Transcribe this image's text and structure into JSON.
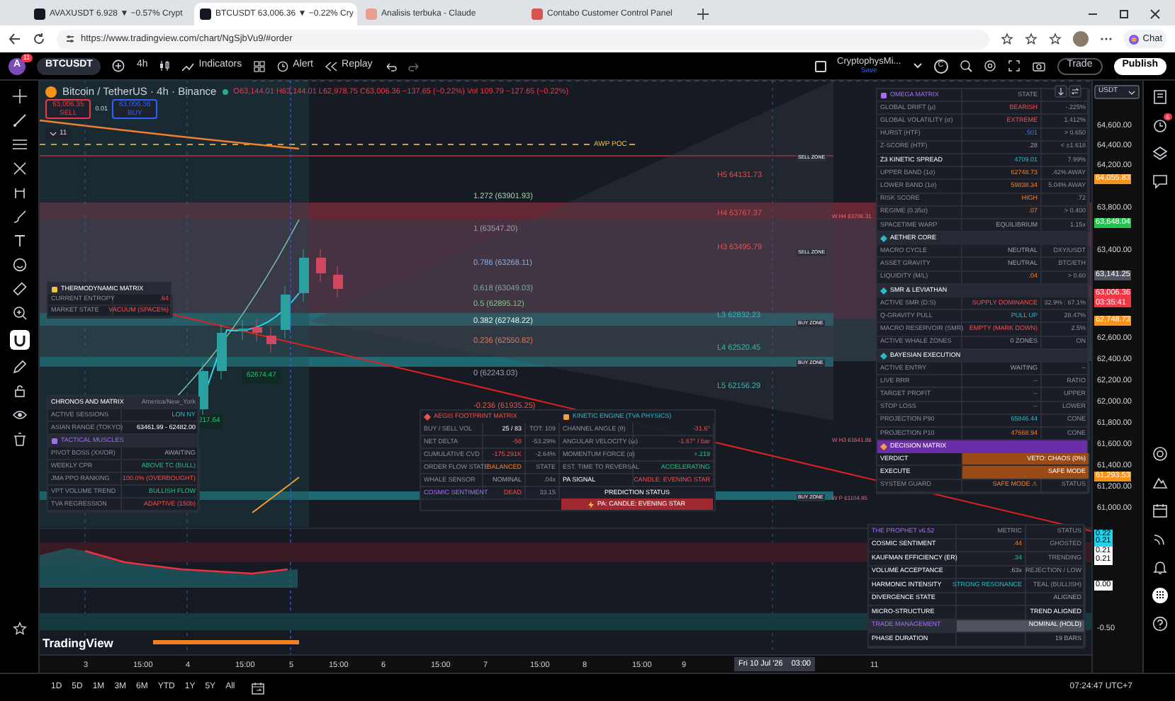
{
  "browser": {
    "tabs": [
      {
        "title": "AVAXUSDT 6.928 ▼ −0.57% Crypt",
        "selected": false
      },
      {
        "title": "BTCUSDT 63,006.36 ▼ −0.22% Cry",
        "selected": true
      },
      {
        "title": "Analisis terbuka - Claude",
        "selected": false
      },
      {
        "title": "Contabo Customer Control Panel",
        "selected": false
      }
    ],
    "url": "https://www.tradingview.com/chart/NgSjbVu9/#order",
    "chat": "Chat"
  },
  "header": {
    "avatar": "A",
    "badge": "11",
    "symbol": "BTCUSDT",
    "interval": "4h",
    "indicators": "Indicators",
    "alert": "Alert",
    "replay": "Replay",
    "layout": "CryptophysMi...",
    "layout_sub": "Save",
    "currency": "C",
    "trade": "Trade",
    "publish": "Publish"
  },
  "legend": {
    "title": "Bitcoin / TetherUS · 4h · Binance",
    "ohlc": "O63,144.01 H63,144.01 L62,978.75 C63,006.36 −137.65 (−0.22%) Vol 109.79 −127.65 (−0.22%)",
    "sell_price": "63,006.35",
    "sell": "SELL",
    "spread": "0.01",
    "buy_price": "63,006.36",
    "buy": "BUY",
    "collapse": "11"
  },
  "fib_labels": [
    {
      "text": "1.272 (63901.93)"
    },
    {
      "text": "1 (63547.20)"
    },
    {
      "text": "0.786 (63268.11)"
    },
    {
      "text": "0.618 (63049.03)"
    },
    {
      "text": "0.5 (62895.12)"
    },
    {
      "text": "0.382 (62748.22)"
    },
    {
      "text": "0.236 (62550.82)"
    },
    {
      "text": "0 (62243.03)"
    },
    {
      "text": "-0.236 (61935.25)"
    }
  ],
  "pivot_labels": [
    {
      "text": "H5 64131.73"
    },
    {
      "text": "H4 63767.37"
    },
    {
      "text": "H3 63495.79"
    },
    {
      "text": "L3 62832.23"
    },
    {
      "text": "L4 62520.45"
    },
    {
      "text": "L5 62156.29"
    }
  ],
  "zone_tags": [
    "SELL ZONE",
    "SELL ZONE",
    "BUY ZONE",
    "BUY ZONE",
    "BUY ZONE"
  ],
  "weekly_labels": [
    "W H4 63706.31",
    "W H3 61641.86",
    "W P 61104.95"
  ],
  "poc_label": "AWP POC",
  "price_tags": [
    "62674.47",
    "217.64"
  ],
  "thermo": {
    "title": "THERMODYNAMIC MATRIX",
    "rows": [
      {
        "label": "CURRENT ENTROPY",
        "value": ".64"
      },
      {
        "label": "MARKET STATE",
        "value": "VACUUM (SPACE%)"
      }
    ]
  },
  "chronos": {
    "title": "CHRONOS AND MATRIX",
    "timezone": "America/New_York",
    "rows": [
      {
        "kind": "row",
        "label": "ACTIVE SESSIONS",
        "value": "LON NY"
      },
      {
        "kind": "row",
        "label": "ASIAN RANGE (TOKYO)",
        "value": "63461.99 - 62482.00"
      },
      {
        "kind": "header",
        "label": "TACTICAL MUSCLES"
      },
      {
        "kind": "row",
        "label": "PIVOT BOSS (XX/OR)",
        "value": "AWAITING"
      },
      {
        "kind": "row",
        "label": "WEEKLY CPR",
        "value": "ABOVE TC (BULL)"
      },
      {
        "kind": "row",
        "label": "JMA PPO RANKING",
        "value": "100.0% (OVERBOUGHT)"
      },
      {
        "kind": "row",
        "label": "VPT VOLUME TREND",
        "value": "BULLISH FLOW"
      },
      {
        "kind": "row",
        "label": "TVA REGRESSION",
        "value": "ADAPTIVE (150b)"
      }
    ]
  },
  "aegis": {
    "title": "AEGIS FOOTPRINT MATRIX",
    "rows": [
      {
        "label": "BUY / SELL VOL",
        "value": "25 / 83",
        "extra": "TOT: 109"
      },
      {
        "label": "NET DELTA",
        "value": "-58",
        "extra": "-53.29%"
      },
      {
        "label": "CUMULATIVE CVD",
        "value": "-175.291K",
        "extra": "-2.64%"
      },
      {
        "label": "ORDER FLOW STATE",
        "value": "BALANCED",
        "extra": "STATE"
      },
      {
        "label": "WHALE SENSOR",
        "value": "NOMINAL",
        "extra": ".04x"
      },
      {
        "label": "COSMIC SENTIMENT",
        "value": "DEAD",
        "extra": "33.15"
      }
    ]
  },
  "kinetic": {
    "title": "KINETIC ENGINE (TVA PHYSICS)",
    "rows": [
      {
        "label": "CHANNEL ANGLE (θ)",
        "value": "-31.6°"
      },
      {
        "label": "ANGULAR VELOCITY (ω)",
        "value": "-1.67° / bar"
      },
      {
        "label": "MOMENTUM FORCE (α)",
        "value": "+.219"
      },
      {
        "label": "EST. TIME TO REVERSAL",
        "value": "ACCELERATING"
      },
      {
        "label": "PA SIGNAL",
        "value": "CANDLE: EVENING STAR"
      }
    ],
    "status_title": "PREDICTION STATUS",
    "status": "PA: CANDLE: EVENING STAR"
  },
  "omega": {
    "title": "OMEGA MATRIX",
    "state": "STATE",
    "rows": [
      {
        "kind": "row",
        "label": "GLOBAL DRIFT (μ)",
        "value": "BEARISH",
        "extra": "-.225%"
      },
      {
        "kind": "row",
        "label": "GLOBAL VOLATILITY (σ)",
        "value": "EXTREME",
        "extra": "1.412%"
      },
      {
        "kind": "row",
        "label": "HURST (HTF)",
        "value": ".501",
        "extra": "> 0.650"
      },
      {
        "kind": "row",
        "label": "Z-SCORE (HTF)",
        "value": ".28",
        "extra": "< ±1.618"
      },
      {
        "kind": "row",
        "label": "Z3 KINETIC SPREAD",
        "value": "4709.01",
        "extra": "7.99%"
      },
      {
        "kind": "row",
        "label": "UPPER BAND (1σ)",
        "value": "62748.73",
        "extra": ".42% AWAY"
      },
      {
        "kind": "row",
        "label": "LOWER BAND (1σ)",
        "value": "59838.34",
        "extra": "5.04% AWAY"
      },
      {
        "kind": "row",
        "label": "RISK SCORE",
        "value": "HIGH",
        "extra": ".72"
      },
      {
        "kind": "row",
        "label": "REGIME (0.35σ)",
        "value": ".07",
        "extra": "> 0.400"
      },
      {
        "kind": "row",
        "label": "SPACETIME WARP",
        "value": "EQUILIBRIUM",
        "extra": "1.15x"
      },
      {
        "kind": "header",
        "label": "AETHER CORE"
      },
      {
        "kind": "row",
        "label": "MACRO CYCLE",
        "value": "NEUTRAL",
        "extra": "DXY/USDT"
      },
      {
        "kind": "row",
        "label": "ASSET GRAVITY",
        "value": "NEUTRAL",
        "extra": "BTC/ETH"
      },
      {
        "kind": "row",
        "label": "LIQUIDITY (M/L)",
        "value": ".04",
        "extra": "> 0.60"
      },
      {
        "kind": "header",
        "label": "SMR & LEVIATHAN"
      },
      {
        "kind": "row",
        "label": "ACTIVE SMR (D:S)",
        "value": "SUPPLY DOMINANCE",
        "extra": "32.9% : 67.1%"
      },
      {
        "kind": "row",
        "label": "Q-GRAVITY PULL",
        "value": "PULL UP",
        "extra": "28.47%"
      },
      {
        "kind": "row",
        "label": "MACRO RESERVOIR (SMR)",
        "value": "EMPTY (MARK DOWN)",
        "extra": "2.5%"
      },
      {
        "kind": "row",
        "label": "ACTIVE WHALE ZONES",
        "value": "0 ZONES",
        "extra": "ON"
      },
      {
        "kind": "header",
        "label": "BAYESIAN EXECUTION"
      },
      {
        "kind": "row",
        "label": "ACTIVE ENTRY",
        "value": "WAITING",
        "extra": "--"
      },
      {
        "kind": "row",
        "label": "LIVE RRR",
        "value": "--",
        "extra": "RATIO"
      },
      {
        "kind": "row",
        "label": "TARGET PROFIT",
        "value": "--",
        "extra": "UPPER"
      },
      {
        "kind": "row",
        "label": "STOP LOSS",
        "value": "--",
        "extra": "LOWER"
      },
      {
        "kind": "row",
        "label": "PROJECTION P90",
        "value": "65846.44",
        "extra": "CONE"
      },
      {
        "kind": "row",
        "label": "PROJECTION P10",
        "value": "47668.94",
        "extra": "CONE"
      },
      {
        "kind": "section",
        "label": "DECISION MATRIX"
      },
      {
        "kind": "verdict",
        "label": "VERDICT",
        "value": "VETO: CHAOS (0%)"
      },
      {
        "kind": "verdict",
        "label": "EXECUTE",
        "value": "SAFE MODE"
      },
      {
        "kind": "row",
        "label": "SYSTEM GUARD",
        "value": "SAFE MODE ⚠",
        "extra": "STATUS"
      }
    ]
  },
  "prophet": {
    "title": "THE PROPHET v6.52",
    "metric": "METRIC",
    "status": "STATUS",
    "rows": [
      {
        "kind": "row",
        "label": "COSMIC SENTIMENT",
        "value": ".44",
        "extra": "GHOSTED"
      },
      {
        "kind": "row",
        "label": "KAUFMAN EFFICIENCY (ER)",
        "value": ".34",
        "extra": "TRENDING"
      },
      {
        "kind": "row",
        "label": "VOLUME ACCEPTANCE",
        "value": ".63x",
        "extra": "REJECTION / LOW"
      },
      {
        "kind": "row",
        "label": "HARMONIC INTENSITY",
        "value": "STRONG RESONANCE",
        "extra": "TEAL (BULLISH)"
      },
      {
        "kind": "row",
        "label": "DIVERGENCE STATE",
        "extra": "ALIGNED"
      },
      {
        "kind": "row",
        "label": "MICRO-STRUCTURE",
        "extra": "TREND ALIGNED"
      },
      {
        "kind": "manage",
        "label": "TRADE MANAGEMENT",
        "extra": "NOMINAL (HOLD)"
      },
      {
        "kind": "row",
        "label": "PHASE DURATION",
        "extra": "19 BARS"
      }
    ]
  },
  "price_axis": {
    "currency": "USDT",
    "labels": [
      {
        "kind": "tick",
        "text": "64,600.00"
      },
      {
        "kind": "tick",
        "text": "64,400.00"
      },
      {
        "kind": "tick",
        "text": "64,200.00"
      },
      {
        "kind": "tag",
        "text": "64,055.83",
        "color": "#f7931a"
      },
      {
        "kind": "tick",
        "text": "63,800.00"
      },
      {
        "kind": "tag",
        "text": "63,648.04",
        "color": "#26c24f"
      },
      {
        "kind": "tick",
        "text": "63,400.00"
      },
      {
        "kind": "tag",
        "text": "63,141.25",
        "color": "#50535e"
      },
      {
        "kind": "tag",
        "text": "63,006.36",
        "sub": "03:35:41",
        "color": "#f23645"
      },
      {
        "kind": "tag",
        "text": "62,748.73",
        "color": "#f7931a"
      },
      {
        "kind": "tick",
        "text": "62,600.00"
      },
      {
        "kind": "tick",
        "text": "62,400.00"
      },
      {
        "kind": "tick",
        "text": "62,200.00"
      },
      {
        "kind": "tick",
        "text": "62,000.00"
      },
      {
        "kind": "tick",
        "text": "61,800.00"
      },
      {
        "kind": "tick",
        "text": "61,600.00"
      },
      {
        "kind": "tick",
        "text": "61,400.00"
      },
      {
        "kind": "tag",
        "text": "61,293.53",
        "color": "#f7931a"
      },
      {
        "kind": "tick",
        "text": "61,200.00"
      },
      {
        "kind": "tick",
        "text": "61,000.00"
      },
      {
        "kind": "tag",
        "text": "0.22",
        "color": "#22d3ee"
      },
      {
        "kind": "tag",
        "text": "0.21",
        "color": "#22d3ee"
      },
      {
        "kind": "tag",
        "text": "0.21",
        "color": "#ffffff"
      },
      {
        "kind": "tag",
        "text": "0.21",
        "color": "#ffffff"
      },
      {
        "kind": "tag",
        "text": "0.00",
        "color": "#ffffff"
      },
      {
        "kind": "tick",
        "text": "-0.50"
      }
    ]
  },
  "time_axis": {
    "labels": [
      "3",
      "15:00",
      "4",
      "15:00",
      "5",
      "15:00",
      "6",
      "15:00",
      "7",
      "15:00",
      "8",
      "15:00",
      "9",
      "11"
    ],
    "cursor": "Fri 10 Jul '26",
    "cursor_time": "03:00"
  },
  "logo": "TradingView",
  "bottom_bar": {
    "ranges": [
      "1D",
      "5D",
      "1M",
      "3M",
      "6M",
      "YTD",
      "1Y",
      "5Y",
      "All"
    ],
    "clock": "07:24:47 UTC+7"
  },
  "sidebar_badge": "6"
}
